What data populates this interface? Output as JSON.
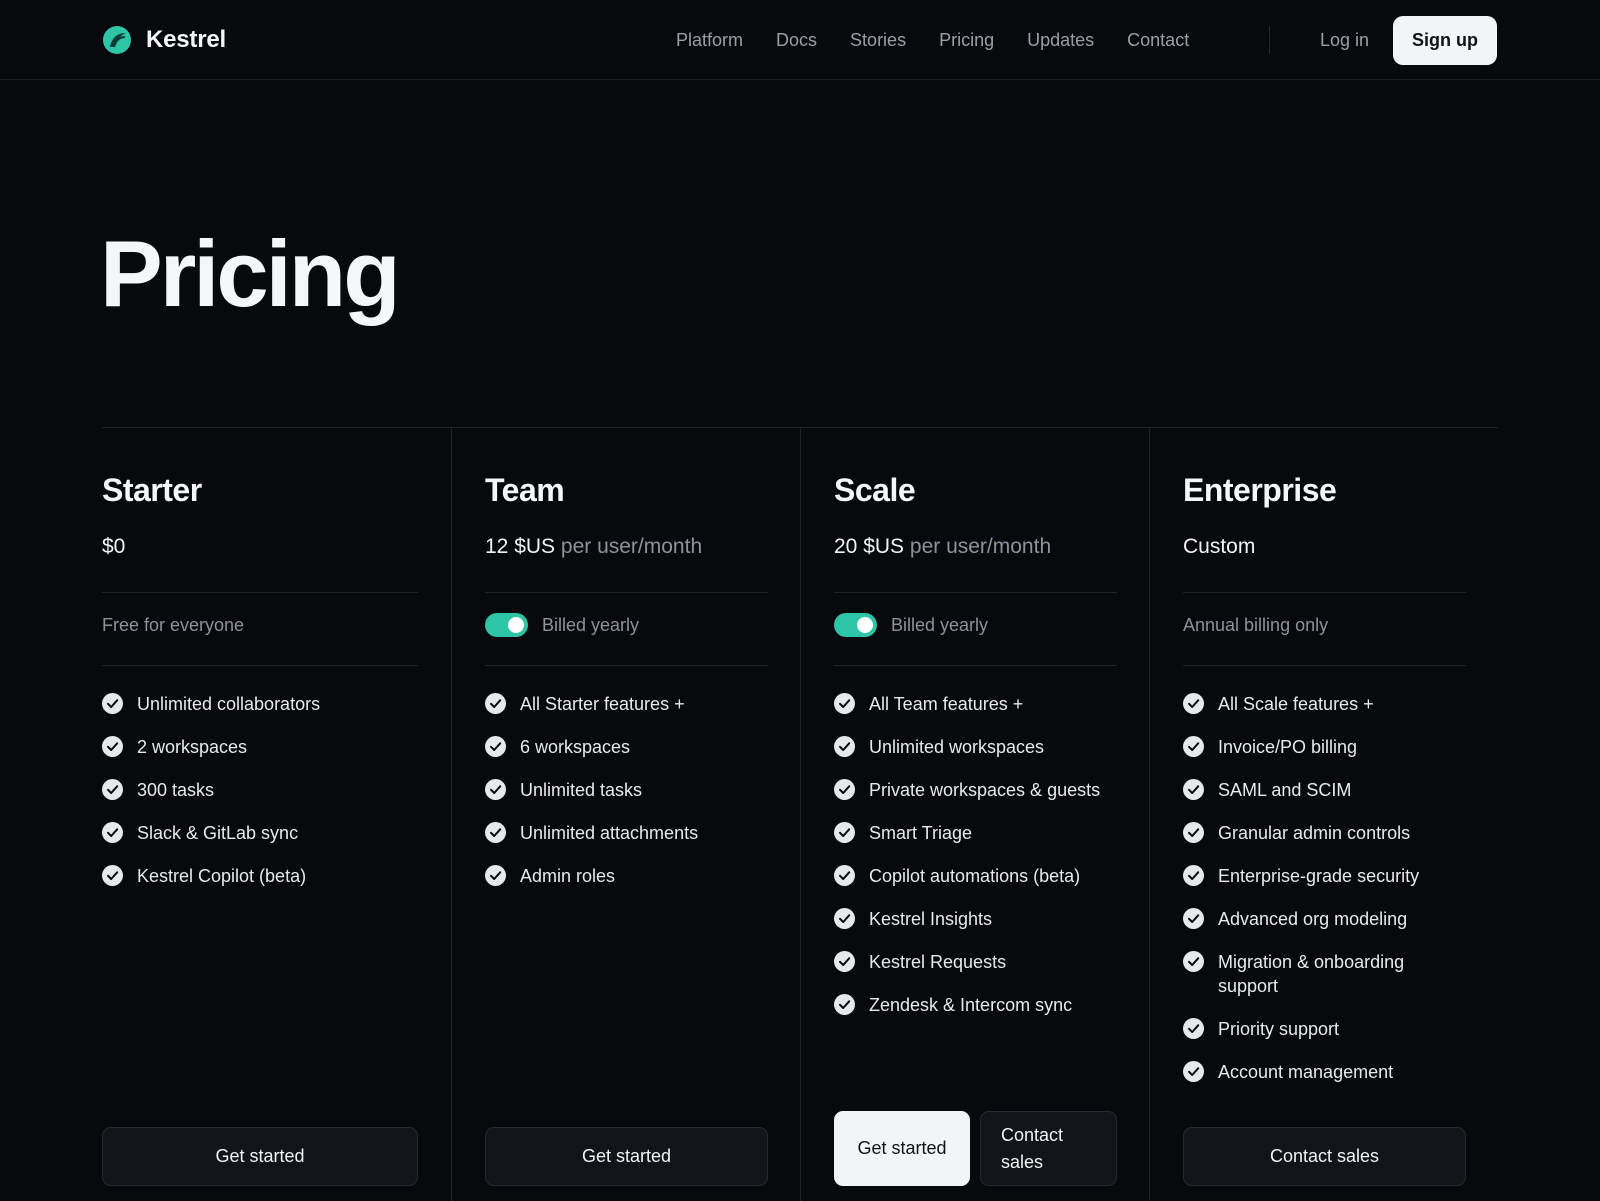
{
  "brand": {
    "name": "Kestrel",
    "accent": "#2ec4a6"
  },
  "nav": {
    "items": [
      "Platform",
      "Docs",
      "Stories",
      "Pricing",
      "Updates",
      "Contact"
    ],
    "login": "Log in",
    "signup": "Sign up"
  },
  "page": {
    "title": "Pricing"
  },
  "plans": [
    {
      "name": "Starter",
      "price": "$0",
      "price_unit": "",
      "billing_text": "Free for everyone",
      "billing_toggle": false,
      "features": [
        "Unlimited collaborators",
        "2 workspaces",
        "300 tasks",
        "Slack & GitLab sync",
        "Kestrel Copilot (beta)"
      ],
      "primary_cta": "Get started"
    },
    {
      "name": "Team",
      "price": "12 $US",
      "price_unit": "per user/month",
      "billing_text": "Billed yearly",
      "billing_toggle": true,
      "features": [
        "All Starter features +",
        "6 workspaces",
        "Unlimited tasks",
        "Unlimited attachments",
        "Admin roles"
      ],
      "primary_cta": "Get started"
    },
    {
      "name": "Scale",
      "price": "20 $US",
      "price_unit": "per user/month",
      "billing_text": "Billed yearly",
      "billing_toggle": true,
      "features": [
        "All Team features +",
        "Unlimited workspaces",
        "Private workspaces & guests",
        "Smart Triage",
        "Copilot automations (beta)",
        "Kestrel Insights",
        "Kestrel Requests",
        "Zendesk & Intercom sync"
      ],
      "primary_cta": "Get started",
      "secondary_cta": "Contact sales"
    },
    {
      "name": "Enterprise",
      "price": "Custom",
      "price_unit": "",
      "billing_text": "Annual billing only",
      "billing_toggle": false,
      "features": [
        "All Scale features +",
        "Invoice/PO billing",
        "SAML and SCIM",
        "Granular admin controls",
        "Enterprise-grade security",
        "Advanced org modeling",
        "Migration & onboarding support",
        "Priority support",
        "Account management"
      ],
      "primary_cta": "Contact sales"
    }
  ]
}
